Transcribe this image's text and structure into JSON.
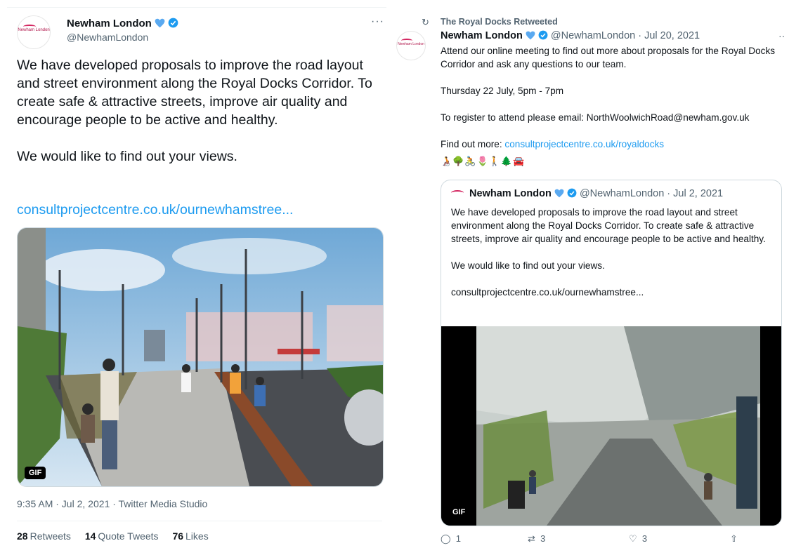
{
  "left": {
    "author_name": "Newham London",
    "author_handle": "@NewhamLondon",
    "avatar_text": "Newham London",
    "more_label": "···",
    "body_paragraphs": [
      "We have developed proposals to improve the road layout and street environment along the Royal Docks Corridor. To create safe & attractive streets, improve air quality and encourage people to be active and healthy.",
      "We would like to find out your views."
    ],
    "link": "consultprojectcentre.co.uk/ournewhamstree...",
    "media_badge": "GIF",
    "timestamp": "9:35 AM · Jul 2, 2021 · Twitter Media Studio",
    "stats": {
      "retweets_count": "28",
      "retweets_label": "Retweets",
      "quotes_count": "14",
      "quotes_label": "Quote Tweets",
      "likes_count": "76",
      "likes_label": "Likes"
    }
  },
  "right": {
    "retweet_icon": "↻",
    "retweet_label": "The Royal Docks Retweeted",
    "author_name": "Newham London",
    "author_handle_date": "@NewhamLondon · Jul 20, 2021",
    "avatar_text": "Newham London",
    "more_label": "··",
    "body": {
      "p1": "Attend our online meeting to find out more about proposals for the Royal Docks Corridor and ask any questions to our team.",
      "p2": "Thursday 22 July, 5pm - 7pm",
      "p3": "To register to attend please email: NorthWoolwichRoad@newham.gov.uk",
      "p4_prefix": "Find out more: ",
      "p4_link": "consultprojectcentre.co.uk/royaldocks"
    },
    "emojis": "🧑‍🦽🌳🚴🌷🚶🌲🚘",
    "quote": {
      "author_name": "Newham London",
      "author_handle_date": "@NewhamLondon · Jul 2, 2021",
      "paragraphs": [
        "We have developed proposals to improve the road layout and street environment along the Royal Docks Corridor. To create safe & attractive streets, improve air quality and encourage people to be active and healthy.",
        "We would like to find out your views.",
        "consultprojectcentre.co.uk/ournewhamstree..."
      ],
      "media_badge": "GIF"
    },
    "actions": {
      "reply_icon": "◯",
      "reply_count": "1",
      "retweet_icon": "⇄",
      "retweet_count": "3",
      "like_icon": "♡",
      "like_count": "3",
      "share_icon": "⇧"
    }
  }
}
